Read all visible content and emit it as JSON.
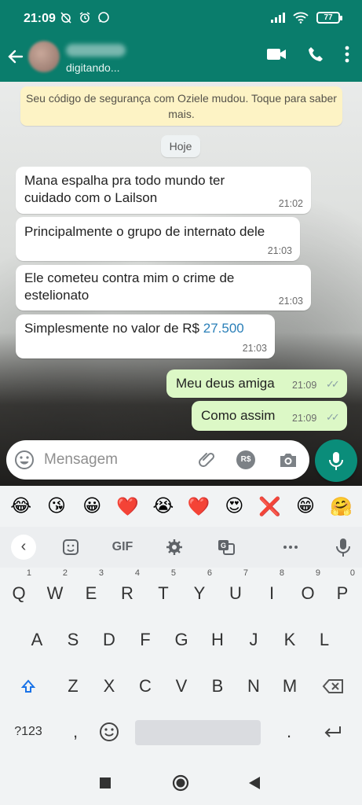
{
  "status_bar": {
    "time": "21:09",
    "battery": "77"
  },
  "header": {
    "contact_status": "digitando...",
    "back_icon": "arrow-left-icon",
    "video_icon": "video-camera-icon",
    "call_icon": "phone-icon",
    "menu_icon": "more-vertical-icon"
  },
  "chat": {
    "security_notice": "Seu código de segurança com Oziele mudou. Toque para saber mais.",
    "date_chip": "Hoje",
    "messages": [
      {
        "direction": "in",
        "lines": [
          "Mana espalha pra todo mundo ter",
          "cuidado com o Lailson"
        ],
        "time": "21:02"
      },
      {
        "direction": "in",
        "lines": [
          "Principalmente o grupo de internato dele"
        ],
        "time": "21:03"
      },
      {
        "direction": "in",
        "lines": [
          "Ele cometeu contra mim o crime de",
          "estelionato"
        ],
        "time": "21:03"
      },
      {
        "direction": "in",
        "text_prefix": "Simplesmente no valor de R$ ",
        "text_link": "27.500",
        "time": "21:03"
      },
      {
        "direction": "out",
        "text": "Meu deus amiga",
        "time": "21:09"
      },
      {
        "direction": "out",
        "text": "Como assim",
        "time": "21:09"
      }
    ]
  },
  "composer": {
    "placeholder": "Mensagem",
    "payment_label": "R$"
  },
  "emoji_suggestions": [
    "😂",
    "😘",
    "😀",
    "❤️",
    "😭",
    "❤️",
    "😍",
    "❌",
    "😁",
    "🤗"
  ],
  "keyboard": {
    "toolbar": {
      "gif_label": "GIF"
    },
    "row1": [
      {
        "key": "Q",
        "num": "1"
      },
      {
        "key": "W",
        "num": "2"
      },
      {
        "key": "E",
        "num": "3"
      },
      {
        "key": "R",
        "num": "4"
      },
      {
        "key": "T",
        "num": "5"
      },
      {
        "key": "Y",
        "num": "6"
      },
      {
        "key": "U",
        "num": "7"
      },
      {
        "key": "I",
        "num": "8"
      },
      {
        "key": "O",
        "num": "9"
      },
      {
        "key": "P",
        "num": "0"
      }
    ],
    "row2": [
      "A",
      "S",
      "D",
      "F",
      "G",
      "H",
      "J",
      "K",
      "L"
    ],
    "row3": [
      "Z",
      "X",
      "C",
      "V",
      "B",
      "N",
      "M"
    ],
    "bottom": {
      "symbols_label": "?123",
      "comma": ",",
      "period": "."
    }
  },
  "colors": {
    "header_bg": "#0a7d6c",
    "incoming_bubble": "#ffffff",
    "outgoing_bubble": "#dcf8c6",
    "security_notice_bg": "#fdf3c5",
    "mic_button": "#0a8d7a",
    "link": "#2a7fb8"
  }
}
